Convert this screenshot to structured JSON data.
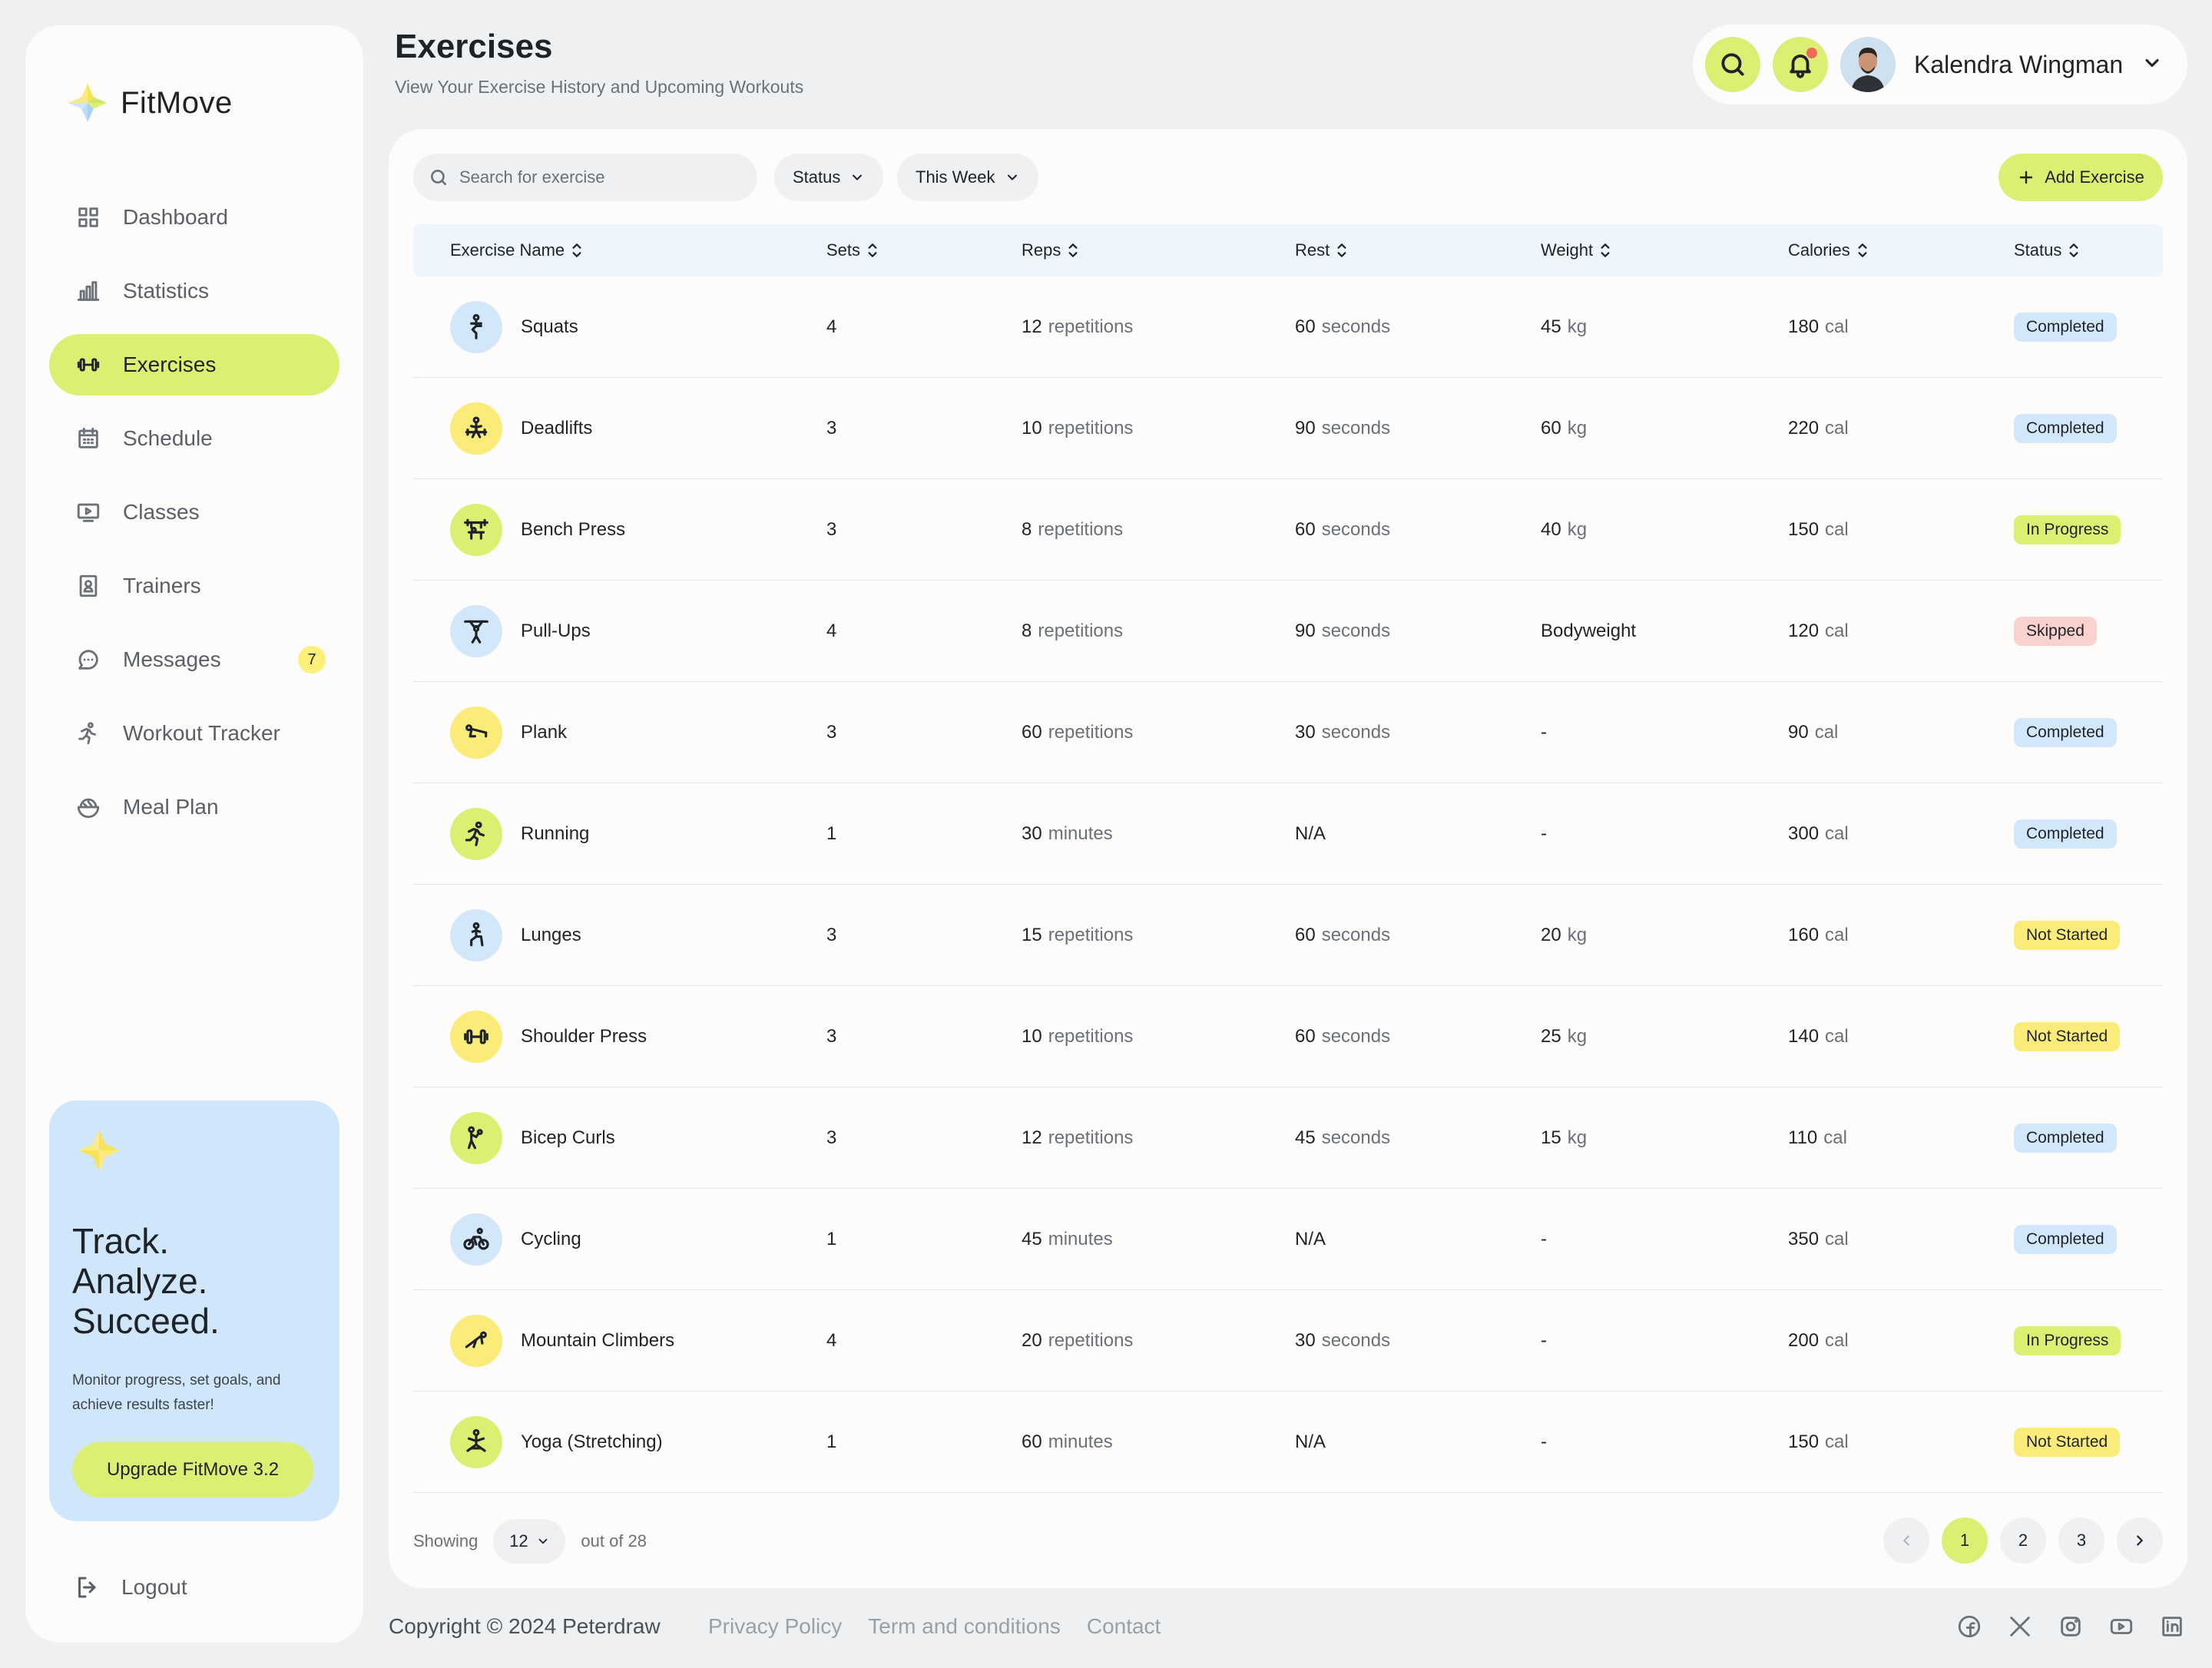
{
  "brand": {
    "name": "FitMove"
  },
  "nav": [
    {
      "label": "Dashboard",
      "icon": "grid-icon"
    },
    {
      "label": "Statistics",
      "icon": "bar-chart-icon"
    },
    {
      "label": "Exercises",
      "icon": "dumbbell-icon",
      "active": true
    },
    {
      "label": "Schedule",
      "icon": "calendar-icon"
    },
    {
      "label": "Classes",
      "icon": "video-icon"
    },
    {
      "label": "Trainers",
      "icon": "id-badge-icon"
    },
    {
      "label": "Messages",
      "icon": "chat-icon",
      "badge": "7"
    },
    {
      "label": "Workout Tracker",
      "icon": "runner-icon"
    },
    {
      "label": "Meal Plan",
      "icon": "bowl-icon"
    }
  ],
  "promo": {
    "title": "Track.\nAnalyze.\nSucceed.",
    "description": "Monitor progress, set goals, and achieve results faster!",
    "button": "Upgrade FitMove 3.2"
  },
  "logout": "Logout",
  "header": {
    "title": "Exercises",
    "subtitle": "View Your Exercise History and Upcoming Workouts",
    "user_name": "Kalendra Wingman"
  },
  "toolbar": {
    "search_placeholder": "Search for exercise",
    "status_filter": "Status",
    "period_filter": "This Week",
    "add_button": "Add Exercise"
  },
  "columns": [
    "Exercise Name",
    "Sets",
    "Reps",
    "Rest",
    "Weight",
    "Calories",
    "Status"
  ],
  "status_colors": {
    "Completed": "#d3e7fb",
    "In Progress": "#dcef72",
    "Skipped": "#f9d2d0",
    "Not Started": "#fbec7a"
  },
  "rows": [
    {
      "name": "Squats",
      "icon": "squat-icon",
      "icon_bg": "#d3e7fb",
      "sets": "4",
      "reps": "12",
      "reps_unit": "repetitions",
      "rest": "60",
      "rest_unit": "seconds",
      "weight": "45",
      "weight_unit": "kg",
      "calories": "180",
      "cal_unit": "cal",
      "status": "Completed"
    },
    {
      "name": "Deadlifts",
      "icon": "deadlift-icon",
      "icon_bg": "#fbec7a",
      "sets": "3",
      "reps": "10",
      "reps_unit": "repetitions",
      "rest": "90",
      "rest_unit": "seconds",
      "weight": "60",
      "weight_unit": "kg",
      "calories": "220",
      "cal_unit": "cal",
      "status": "Completed"
    },
    {
      "name": "Bench Press",
      "icon": "bench-press-icon",
      "icon_bg": "#dcef72",
      "sets": "3",
      "reps": "8",
      "reps_unit": "repetitions",
      "rest": "60",
      "rest_unit": "seconds",
      "weight": "40",
      "weight_unit": "kg",
      "calories": "150",
      "cal_unit": "cal",
      "status": "In Progress"
    },
    {
      "name": "Pull-Ups",
      "icon": "pullup-icon",
      "icon_bg": "#d3e7fb",
      "sets": "4",
      "reps": "8",
      "reps_unit": "repetitions",
      "rest": "90",
      "rest_unit": "seconds",
      "weight": "Bodyweight",
      "weight_unit": "",
      "calories": "120",
      "cal_unit": "cal",
      "status": "Skipped"
    },
    {
      "name": "Plank",
      "icon": "plank-icon",
      "icon_bg": "#fbec7a",
      "sets": "3",
      "reps": "60",
      "reps_unit": "repetitions",
      "rest": "30",
      "rest_unit": "seconds",
      "weight": "-",
      "weight_unit": "",
      "calories": "90",
      "cal_unit": "cal",
      "status": "Completed"
    },
    {
      "name": "Running",
      "icon": "running-icon",
      "icon_bg": "#dcef72",
      "sets": "1",
      "reps": "30",
      "reps_unit": "minutes",
      "rest": "N/A",
      "rest_unit": "",
      "weight": "-",
      "weight_unit": "",
      "calories": "300",
      "cal_unit": "cal",
      "status": "Completed"
    },
    {
      "name": "Lunges",
      "icon": "lunge-icon",
      "icon_bg": "#d3e7fb",
      "sets": "3",
      "reps": "15",
      "reps_unit": "repetitions",
      "rest": "60",
      "rest_unit": "seconds",
      "weight": "20",
      "weight_unit": "kg",
      "calories": "160",
      "cal_unit": "cal",
      "status": "Not Started"
    },
    {
      "name": "Shoulder Press",
      "icon": "dumbbell-icon",
      "icon_bg": "#fbec7a",
      "sets": "3",
      "reps": "10",
      "reps_unit": "repetitions",
      "rest": "60",
      "rest_unit": "seconds",
      "weight": "25",
      "weight_unit": "kg",
      "calories": "140",
      "cal_unit": "cal",
      "status": "Not Started"
    },
    {
      "name": "Bicep Curls",
      "icon": "bicep-curl-icon",
      "icon_bg": "#dcef72",
      "sets": "3",
      "reps": "12",
      "reps_unit": "repetitions",
      "rest": "45",
      "rest_unit": "seconds",
      "weight": "15",
      "weight_unit": "kg",
      "calories": "110",
      "cal_unit": "cal",
      "status": "Completed"
    },
    {
      "name": "Cycling",
      "icon": "cycling-icon",
      "icon_bg": "#d3e7fb",
      "sets": "1",
      "reps": "45",
      "reps_unit": "minutes",
      "rest": "N/A",
      "rest_unit": "",
      "weight": "-",
      "weight_unit": "",
      "calories": "350",
      "cal_unit": "cal",
      "status": "Completed"
    },
    {
      "name": "Mountain Climbers",
      "icon": "mountain-climber-icon",
      "icon_bg": "#fbec7a",
      "sets": "4",
      "reps": "20",
      "reps_unit": "repetitions",
      "rest": "30",
      "rest_unit": "seconds",
      "weight": "-",
      "weight_unit": "",
      "calories": "200",
      "cal_unit": "cal",
      "status": "In Progress"
    },
    {
      "name": "Yoga (Stretching)",
      "icon": "yoga-icon",
      "icon_bg": "#dcef72",
      "sets": "1",
      "reps": "60",
      "reps_unit": "minutes",
      "rest": "N/A",
      "rest_unit": "",
      "weight": "-",
      "weight_unit": "",
      "calories": "150",
      "cal_unit": "cal",
      "status": "Not Started"
    }
  ],
  "pagination": {
    "showing_label": "Showing",
    "per_page": "12",
    "total_label": "out of 28",
    "pages": [
      "1",
      "2",
      "3"
    ],
    "current": "1"
  },
  "footer": {
    "copyright": "Copyright © 2024 Peterdraw",
    "links": [
      "Privacy Policy",
      "Term and conditions",
      "Contact"
    ],
    "socials": [
      "facebook-icon",
      "x-icon",
      "instagram-icon",
      "youtube-icon",
      "linkedin-icon"
    ]
  }
}
